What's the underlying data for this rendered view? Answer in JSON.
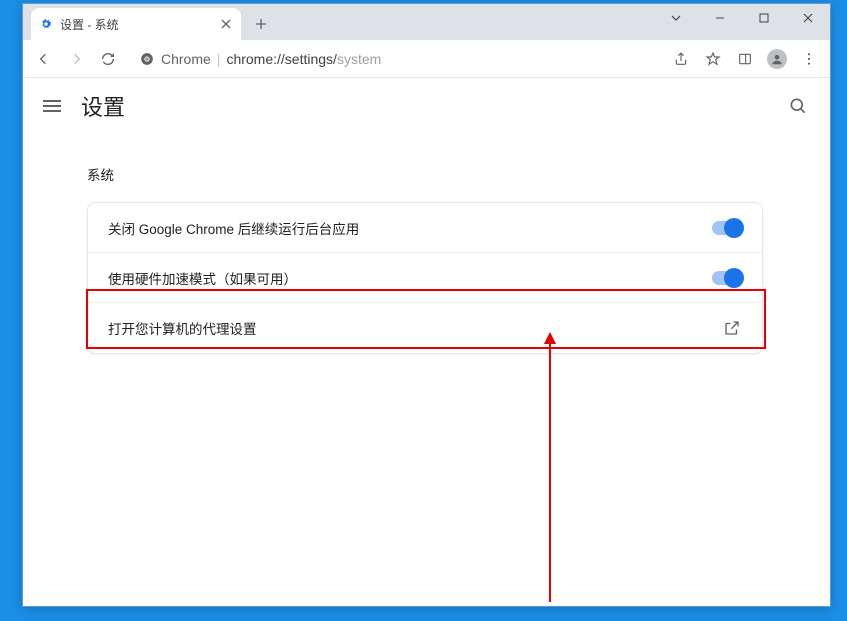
{
  "tab": {
    "title": "设置 - 系统"
  },
  "omnibox": {
    "source_label": "Chrome",
    "url_prefix": "chrome://settings/",
    "url_page": "system"
  },
  "page": {
    "title": "设置",
    "section_title": "系统",
    "rows": [
      {
        "label": "关闭 Google Chrome 后继续运行后台应用",
        "toggle_on": true
      },
      {
        "label": "使用硬件加速模式（如果可用）",
        "toggle_on": true
      },
      {
        "label": "打开您计算机的代理设置",
        "external": true
      }
    ]
  }
}
